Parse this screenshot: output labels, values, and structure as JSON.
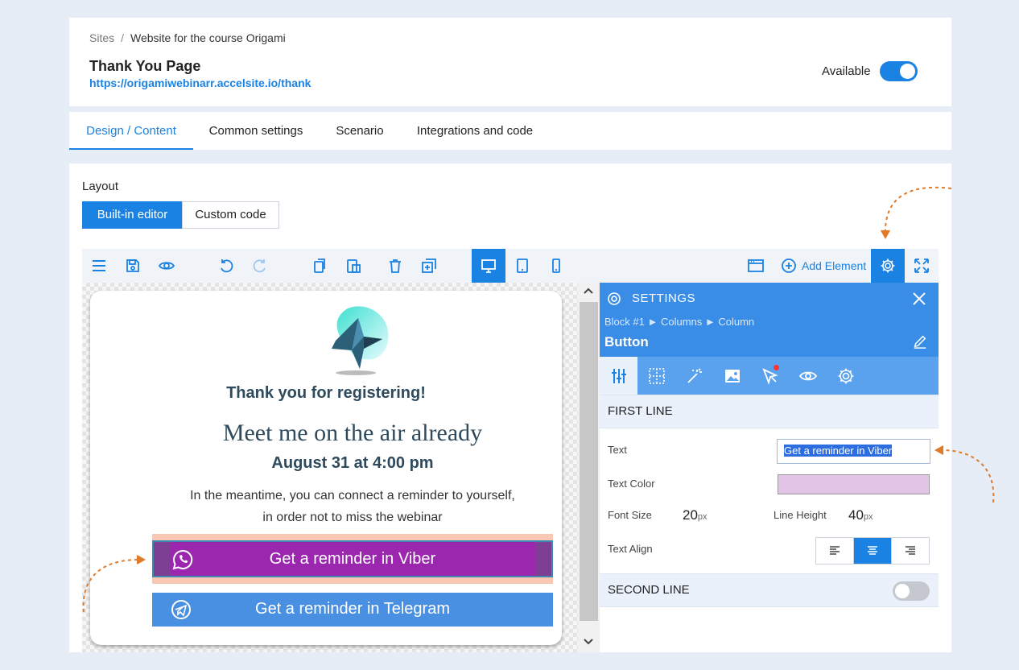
{
  "header": {
    "breadcrumb_root": "Sites",
    "breadcrumb_sep": "/",
    "breadcrumb_current": "Website for the course Origami",
    "title": "Thank You Page",
    "url": "https://origamiwebinarr.accelsite.io/thank",
    "available_label": "Available",
    "available": true
  },
  "tabs": [
    {
      "label": "Design / Content",
      "active": true
    },
    {
      "label": "Common settings",
      "active": false
    },
    {
      "label": "Scenario",
      "active": false
    },
    {
      "label": "Integrations and code",
      "active": false
    }
  ],
  "layout": {
    "label": "Layout",
    "builtin_label": "Built-in editor",
    "custom_label": "Custom code"
  },
  "toolbar": {
    "add_element_label": "Add Element",
    "icons": [
      "menu-icon",
      "save-icon",
      "preview-eye-icon",
      "undo-icon",
      "redo-icon",
      "copy-icon",
      "paste-icon",
      "trash-icon",
      "duplicate-icon",
      "desktop-icon",
      "tablet-icon",
      "mobile-icon",
      "window-icon",
      "plus-circle-icon",
      "gear-icon",
      "fullscreen-icon"
    ]
  },
  "preview": {
    "heading": "Thank you for registering!",
    "meet": "Meet me on the air already",
    "date": "August 31 at 4:00 pm",
    "meantime_1": "In the meantime, you can connect a reminder to yourself,",
    "meantime_2": "in order not to miss the webinar",
    "viber_button": "Get a reminder in Viber",
    "telegram_button": "Get a reminder in Telegram"
  },
  "settings": {
    "title": "SETTINGS",
    "crumbs": "Block #1 ► Columns ► Column",
    "element_name": "Button",
    "first_line": "FIRST LINE",
    "text_label": "Text",
    "text_value": "Get a reminder in Viber",
    "text_color_label": "Text Color",
    "text_color": "#e2c5e6",
    "font_size_label": "Font Size",
    "font_size": "20",
    "line_height_label": "Line Height",
    "line_height": "40",
    "unit": "px",
    "text_align_label": "Text Align",
    "text_align": "center",
    "second_line": "SECOND LINE",
    "second_line_enabled": false
  },
  "colors": {
    "accent": "#1a82e2",
    "viber": "#9b27af",
    "telegram": "#4a90e2",
    "annotation_arrow": "#e07b2a"
  }
}
